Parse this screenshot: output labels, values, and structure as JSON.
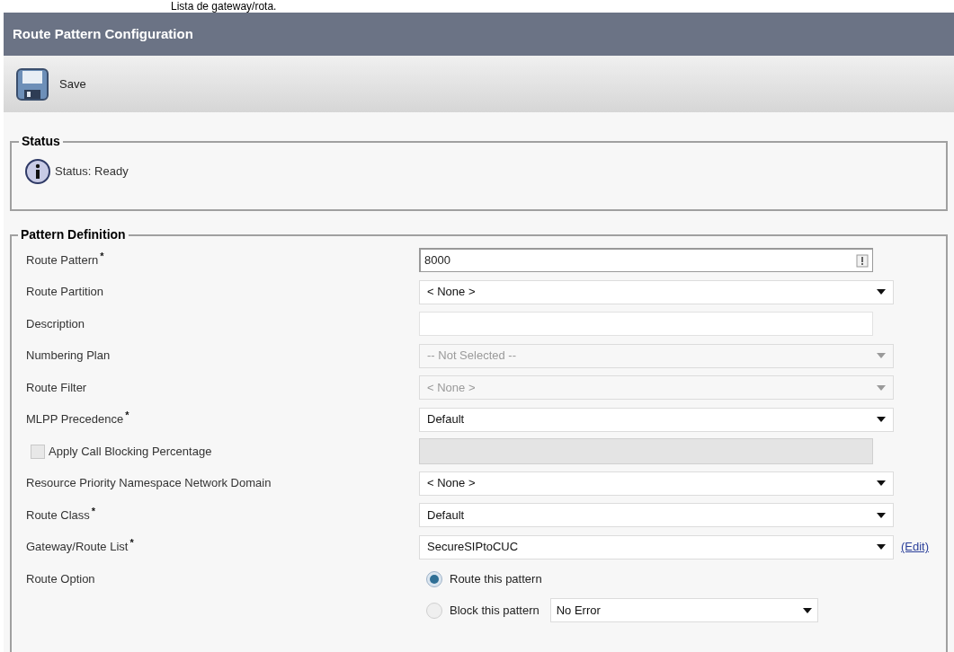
{
  "caption": "Lista de gateway/rota.",
  "header": {
    "title": "Route Pattern Configuration"
  },
  "toolbar": {
    "buttons": [
      {
        "label": "Save"
      }
    ]
  },
  "status": {
    "legend": "Status",
    "message": "Status: Ready"
  },
  "pattern_definition": {
    "legend": "Pattern Definition",
    "rows": [
      {
        "kind": "text_icon",
        "label": "Route Pattern",
        "required_mark": "*",
        "value": "8000"
      },
      {
        "kind": "select",
        "label": "Route Partition",
        "value": "< None >",
        "disabled": false
      },
      {
        "kind": "text",
        "label": "Description"
      },
      {
        "kind": "select",
        "label": "Numbering Plan",
        "value": "-- Not Selected --",
        "disabled": true
      },
      {
        "kind": "select",
        "label": "Route Filter",
        "value": "< None >",
        "disabled": true
      },
      {
        "kind": "select",
        "label": "MLPP Precedence",
        "required_mark": "*",
        "value": "Default",
        "disabled": false
      },
      {
        "kind": "checkbox",
        "label": "Apply Call Blocking Percentage",
        "checked": false,
        "disabled": true
      },
      {
        "kind": "select",
        "label": "Resource Priority Namespace Network Domain",
        "value": "< None >",
        "disabled": false
      },
      {
        "kind": "select",
        "label": "Route Class",
        "required_mark": "*",
        "value": "Default",
        "disabled": false
      },
      {
        "kind": "select",
        "label": "Gateway/Route List",
        "required_mark": "*",
        "value": "SecureSIPtoCUC",
        "disabled": false,
        "link": "(Edit)"
      },
      {
        "kind": "radio",
        "label": "Route Option",
        "options": [
          {
            "label": "Route this pattern",
            "selected": true
          },
          {
            "label": "Block this pattern",
            "selected": false,
            "select_value": "No Error"
          }
        ]
      }
    ]
  }
}
